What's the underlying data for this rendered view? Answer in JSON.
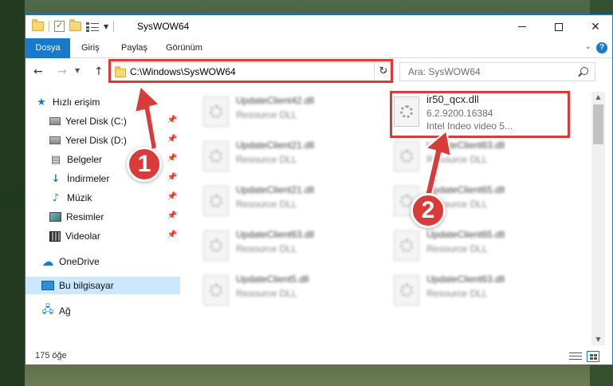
{
  "window": {
    "title": "SysWOW64",
    "controls": {
      "minimize": "",
      "maximize": "",
      "close": "✕"
    }
  },
  "ribbon": {
    "file_tab": "Dosya",
    "tabs": [
      "Giriş",
      "Paylaş",
      "Görünüm"
    ]
  },
  "navigation": {
    "back": "←",
    "forward": "→",
    "up": "↑",
    "address": "C:\\Windows\\SysWOW64",
    "refresh": "↻",
    "search_placeholder": "Ara: SysWOW64"
  },
  "sidebar": {
    "quick_access": "Hızlı erişim",
    "items": [
      {
        "label": "Yerel Disk (C:)",
        "icon": "drive-icon",
        "pinned": true
      },
      {
        "label": "Yerel Disk (D:)",
        "icon": "drive-icon",
        "pinned": true
      },
      {
        "label": "Belgeler",
        "icon": "documents-icon",
        "pinned": true
      },
      {
        "label": "İndirmeler",
        "icon": "downloads-icon",
        "pinned": true
      },
      {
        "label": "Müzik",
        "icon": "music-icon",
        "pinned": true
      },
      {
        "label": "Resimler",
        "icon": "pictures-icon",
        "pinned": true
      },
      {
        "label": "Videolar",
        "icon": "videos-icon",
        "pinned": true
      }
    ],
    "onedrive": "OneDrive",
    "this_pc": "Bu bilgisayar",
    "network": "Ağ"
  },
  "files": {
    "left_column": [
      {
        "name": "UpdateClient42.dll",
        "type": "Resource DLL"
      },
      {
        "name": "UpdateClient21.dll",
        "type": "Resource DLL"
      },
      {
        "name": "UpdateClient21.dll",
        "type": "Resource DLL"
      },
      {
        "name": "UpdateClient63.dll",
        "type": "Resource DLL"
      },
      {
        "name": "UpdateClient5.dll",
        "type": "Resource DLL"
      }
    ],
    "highlighted": {
      "name": "ir50_qcx.dll",
      "version": "6.2.9200.16384",
      "description": "Intel Indeo video 5..."
    },
    "right_column": [
      {
        "name": "UpdateClient63.dll",
        "type": "Resource DLL"
      },
      {
        "name": "UpdateClient65.dll",
        "type": "Resource DLL"
      },
      {
        "name": "UpdateClient65.dll",
        "type": "Resource DLL"
      },
      {
        "name": "UpdateClient63.dll",
        "type": "Resource DLL"
      }
    ]
  },
  "status": {
    "item_count": "175 öğe"
  },
  "annotations": {
    "callout_1": "1",
    "callout_2": "2",
    "color": "#d93a3a"
  },
  "colors": {
    "accent": "#1979ca",
    "selection": "#cce8ff"
  }
}
